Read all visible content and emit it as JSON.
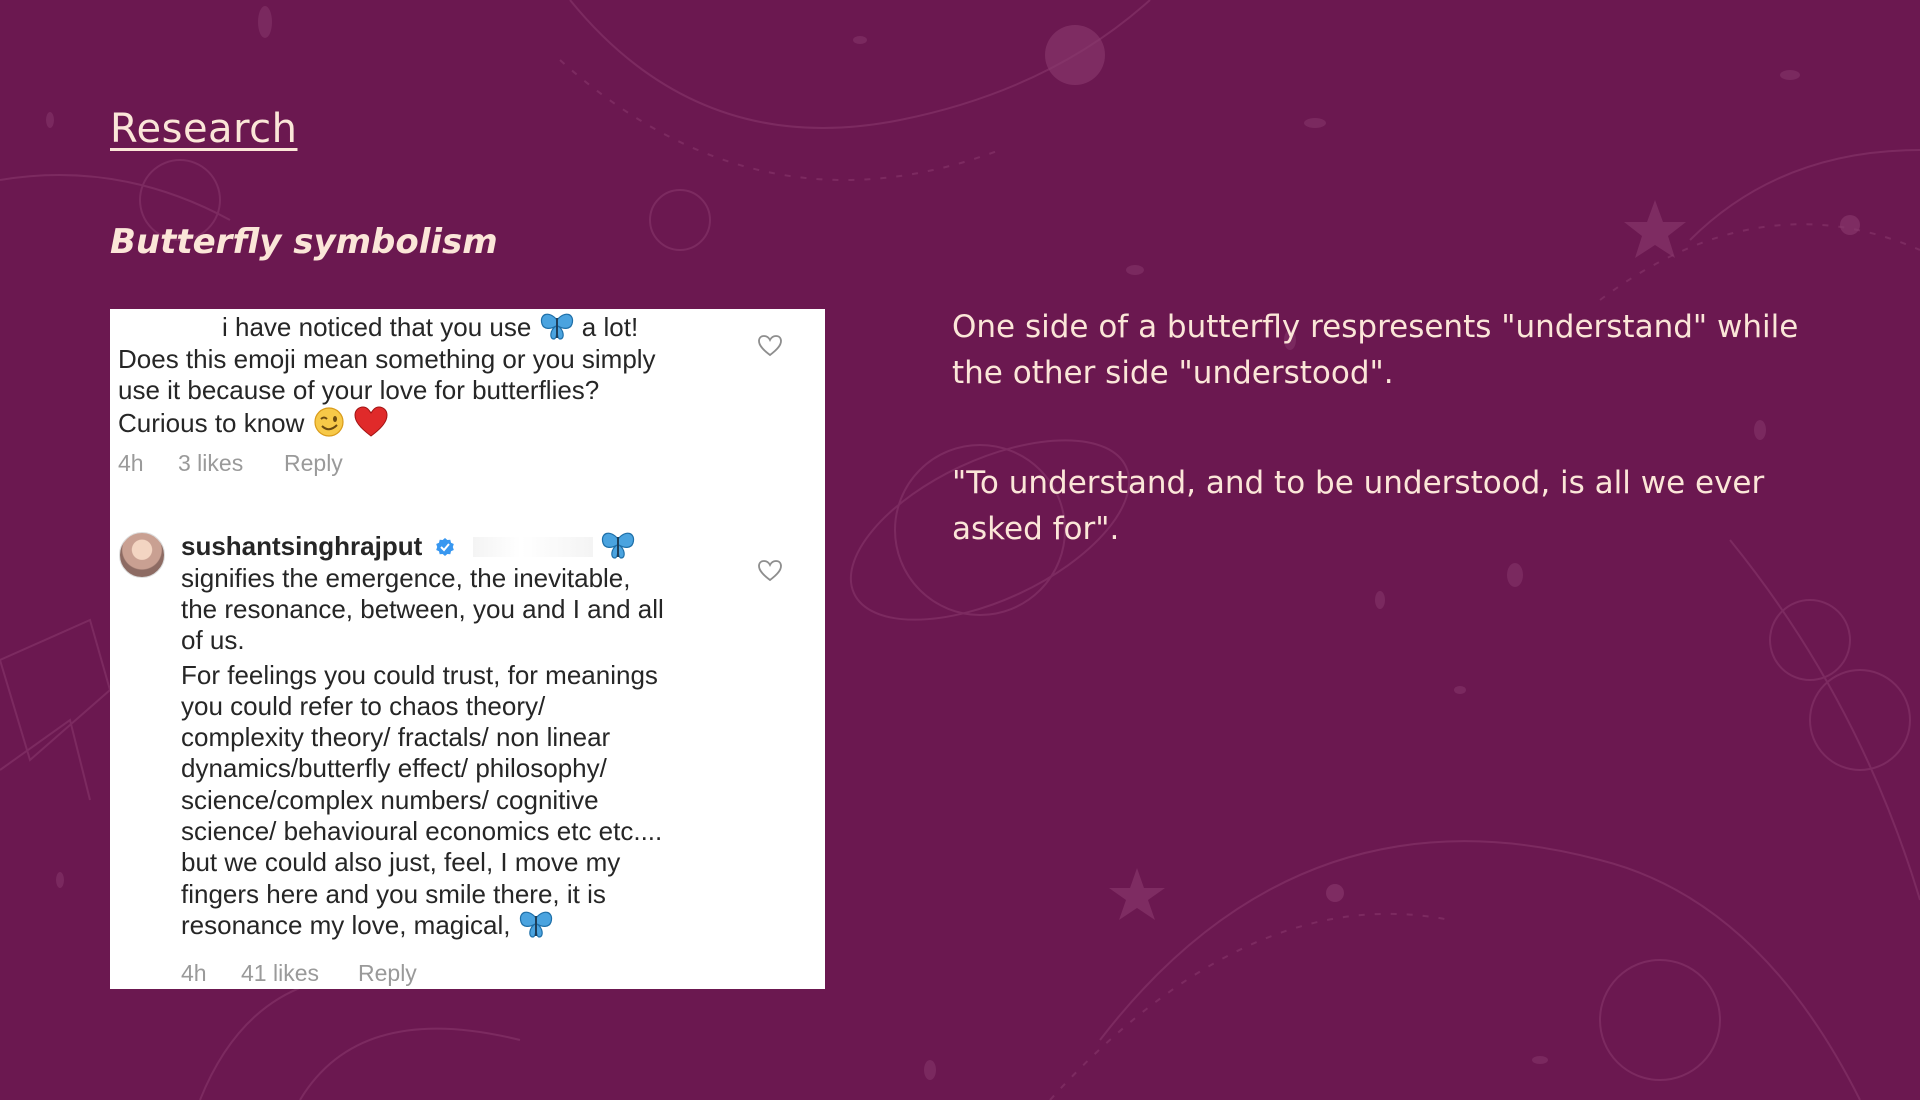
{
  "slide": {
    "title": "Research",
    "subtitle": "Butterfly symbolism",
    "paragraph1": "One side of a butterfly respresents \"understand\" while the other side \"understood\".",
    "paragraph2": "\"To understand, and to be understood, is all we ever asked for\"."
  },
  "screenshot": {
    "comment1": {
      "line1_start": "i have noticed that you use",
      "line1_end": "a lot!",
      "line2": "Does this emoji mean something or you simply",
      "line3": "use it because of your love for butterflies?",
      "line4": "Curious to know",
      "time": "4h",
      "likes": "3 likes",
      "reply": "Reply"
    },
    "comment2": {
      "username": "sushantsinghrajput",
      "lines": [
        "signifies the emergence, the inevitable,",
        "the resonance, between, you and I and all",
        "of us.",
        "For feelings you could trust, for meanings",
        "you could refer to chaos theory/",
        "complexity theory/ fractals/ non linear",
        "dynamics/butterfly effect/ philosophy/",
        "science/complex numbers/ cognitive",
        "science/ behavioural economics etc etc....",
        "but we could also just, feel, I move my",
        "fingers here and you smile there, it is",
        "resonance my love, magical,"
      ],
      "time": "4h",
      "likes": "41 likes",
      "reply": "Reply"
    }
  },
  "colors": {
    "background": "#6b1850",
    "text": "#fbe6d8",
    "verified": "#3897f0",
    "butterfly": "#4aa3df"
  },
  "icons": [
    "butterfly-emoji-icon",
    "wink-emoji-icon",
    "red-heart-emoji-icon",
    "heart-outline-icon",
    "verified-badge-icon"
  ]
}
